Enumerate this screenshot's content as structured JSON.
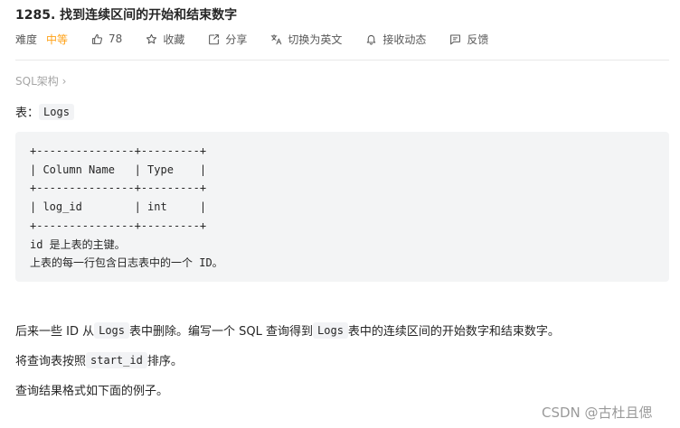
{
  "title": "1285. 找到连续区间的开始和结束数字",
  "meta": {
    "difficulty_label": "难度",
    "difficulty_value": "中等",
    "likes": "78",
    "favorite": "收藏",
    "share": "分享",
    "switch_lang": "切换为英文",
    "subscribe": "接收动态",
    "feedback": "反馈"
  },
  "breadcrumb": "SQL架构 ›",
  "table_intro": {
    "label": "表：",
    "name": "Logs"
  },
  "schema_block": "+---------------+---------+\n| Column Name   | Type    |\n+---------------+---------+\n| log_id        | int     |\n+---------------+---------+\nid 是上表的主键。\n上表的每一行包含日志表中的一个 ID。",
  "paragraphs": {
    "p1_a": "后来一些 ID 从 ",
    "p1_code1": "Logs",
    "p1_b": " 表中删除。编写一个 SQL 查询得到 ",
    "p1_code2": "Logs",
    "p1_c": " 表中的连续区间的开始数字和结束数字。",
    "p2_a": "将查询表按照 ",
    "p2_code": "start_id",
    "p2_b": " 排序。",
    "p3": "查询结果格式如下面的例子。"
  },
  "watermark": "CSDN @古杜且偲",
  "colors": {
    "difficulty_medium": "#ffa116",
    "code_bg": "#f3f4f5"
  },
  "icons": [
    "thumbs-up-icon",
    "star-icon",
    "share-icon",
    "translate-icon",
    "bell-icon",
    "feedback-icon"
  ]
}
